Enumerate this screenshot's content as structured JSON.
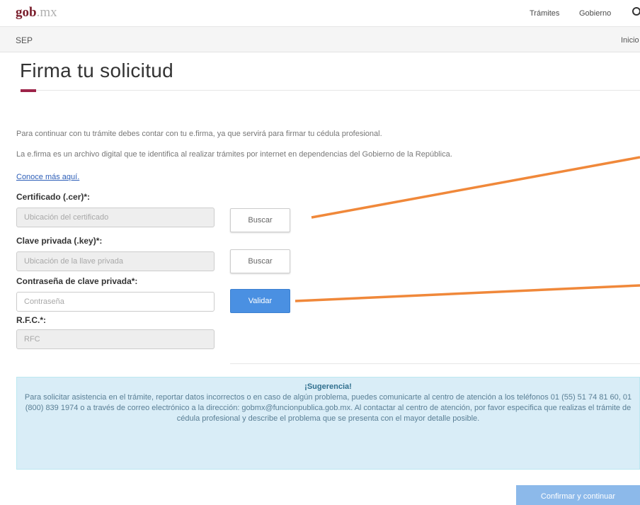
{
  "header": {
    "logo_gob": "gob",
    "logo_mx": ".mx",
    "nav": [
      "Trámites",
      "Gobierno"
    ],
    "search_icon": "search-icon"
  },
  "subheader": {
    "section": "SEP",
    "inicio": "Inicio"
  },
  "page": {
    "title": "Firma tu solicitud",
    "accent_color": "#9d2449"
  },
  "intro": {
    "line1": "Para continuar con tu trámite debes contar con tu e.firma, ya que servirá para firmar tu cédula profesional.",
    "line2": "La e.firma es un archivo digital que te identifica al realizar trámites por internet en dependencias del Gobierno de la República.",
    "link": "Conoce más aquí."
  },
  "form": {
    "cert": {
      "label": "Certificado (.cer)*:",
      "placeholder": "Ubicación del certificado",
      "button": "Buscar"
    },
    "key": {
      "label": "Clave privada (.key)*:",
      "placeholder": "Ubicación de la llave privada",
      "button": "Buscar"
    },
    "password": {
      "label": "Contraseña de clave privada*:",
      "placeholder": "Contraseña",
      "button": "Validar"
    },
    "rfc": {
      "label": "R.F.C.*:",
      "placeholder": "RFC"
    }
  },
  "alert": {
    "title": "¡Sugerencia!",
    "body": "Para solicitar asistencia en el trámite, reportar datos incorrectos o en caso de algún problema, puedes comunicarte al centro de atención a los teléfonos 01 (55) 51 74 81 60, 01 (800) 839 1974 o a través de correo electrónico a la dirección: gobmx@funcionpublica.gob.mx. Al contactar al centro de atención, por favor especifica que realizas el trámite de cédula profesional y describe el problema que se presenta con el mayor detalle posible."
  },
  "footer": {
    "confirm": "Confirmar y continuar"
  },
  "colors": {
    "primary": "#4a90e2",
    "annotation": "#f0883a",
    "alert_bg": "#d9edf7"
  }
}
